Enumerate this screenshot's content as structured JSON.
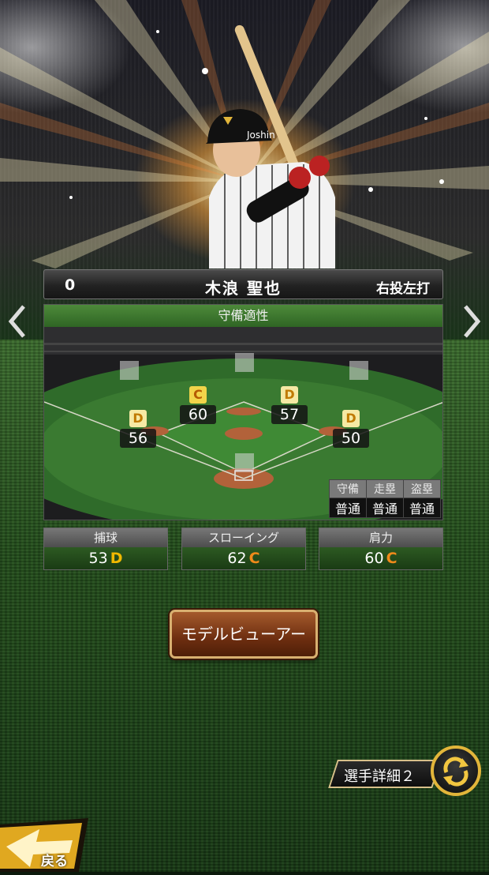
{
  "player": {
    "number": "0",
    "name": "木浪 聖也",
    "throw_bat": "右投左打"
  },
  "defense": {
    "title": "守備適性",
    "positions": [
      {
        "grade": "D",
        "value": "56"
      },
      {
        "grade": "C",
        "value": "60"
      },
      {
        "grade": "D",
        "value": "57"
      },
      {
        "grade": "D",
        "value": "50"
      }
    ],
    "ranks": {
      "headers": [
        "守備",
        "走塁",
        "盗塁"
      ],
      "values": [
        "普通",
        "普通",
        "普通"
      ]
    }
  },
  "stats": [
    {
      "label": "捕球",
      "value": "53",
      "grade": "D"
    },
    {
      "label": "スローイング",
      "value": "62",
      "grade": "C"
    },
    {
      "label": "肩力",
      "value": "60",
      "grade": "C"
    }
  ],
  "buttons": {
    "model_viewer": "モデルビューアー",
    "detail": "選手詳細２",
    "back": "戻る"
  },
  "icons": {
    "prev": "chevron-left-icon",
    "next": "chevron-right-icon",
    "cycle": "cycle-arrows-icon",
    "back": "back-arrow-icon"
  },
  "colors": {
    "grade_d": "#f0b800",
    "grade_c": "#f08a1a",
    "panel_green": "#2f6524",
    "button_brown": "#6e2e10",
    "gold": "#e2b53a"
  }
}
